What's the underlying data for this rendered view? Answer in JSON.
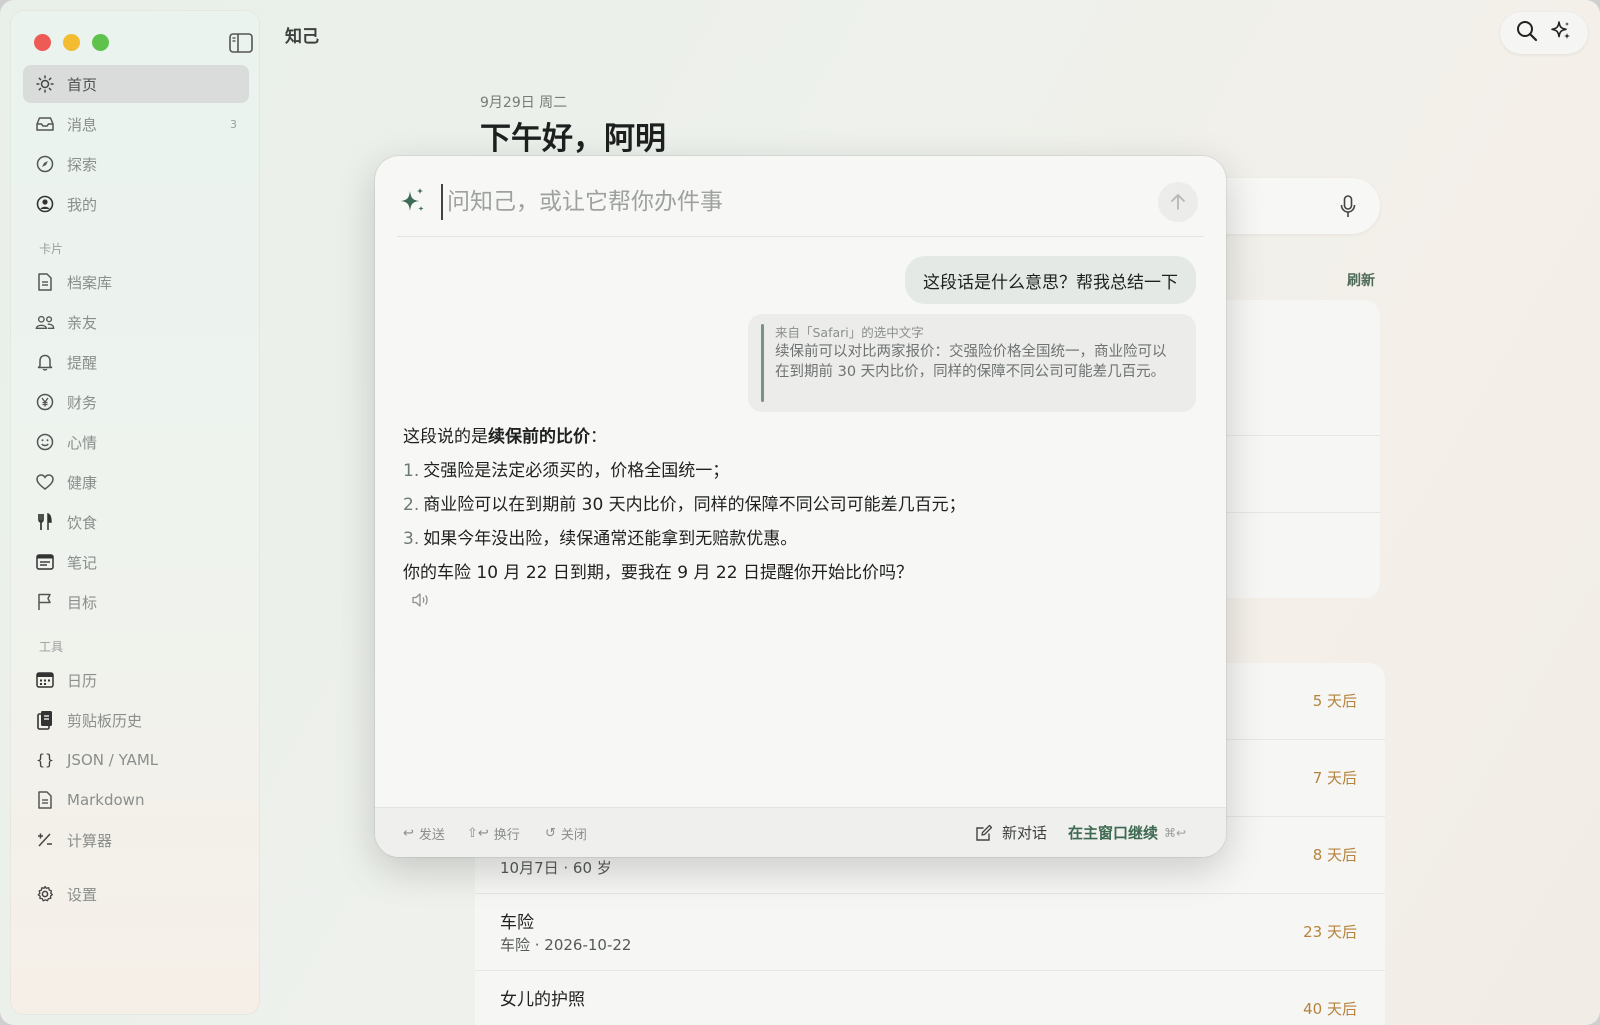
{
  "app": {
    "title": "知己"
  },
  "sidebar": {
    "items": [
      {
        "label": "首页",
        "icon": "sun-icon",
        "active": true
      },
      {
        "label": "消息",
        "icon": "inbox-icon",
        "badge": "3"
      },
      {
        "label": "探索",
        "icon": "compass-icon"
      },
      {
        "label": "我的",
        "icon": "user-circle-icon"
      }
    ],
    "cards_label": "卡片",
    "cards": [
      {
        "label": "档案库",
        "icon": "document-icon"
      },
      {
        "label": "亲友",
        "icon": "people-icon"
      },
      {
        "label": "提醒",
        "icon": "bell-icon"
      },
      {
        "label": "财务",
        "icon": "yen-icon"
      },
      {
        "label": "心情",
        "icon": "smiley-icon"
      },
      {
        "label": "健康",
        "icon": "heart-icon"
      },
      {
        "label": "饮食",
        "icon": "fork-knife-icon"
      },
      {
        "label": "笔记",
        "icon": "notes-icon"
      },
      {
        "label": "目标",
        "icon": "flag-icon"
      }
    ],
    "tools_label": "工具",
    "tools": [
      {
        "label": "日历",
        "icon": "calendar-icon"
      },
      {
        "label": "剪贴板历史",
        "icon": "clipboard-icon"
      },
      {
        "label": "JSON / YAML",
        "icon": "braces-icon"
      },
      {
        "label": "Markdown",
        "icon": "markdown-file-icon"
      },
      {
        "label": "计算器",
        "icon": "calculator-icon"
      }
    ],
    "settings": {
      "label": "设置",
      "icon": "gear-icon"
    }
  },
  "home": {
    "date": "9月29日 周二",
    "greeting": "下午好，阿明",
    "refresh": "刷新",
    "reminders": [
      {
        "title": "",
        "sub": "",
        "due": "5 天后"
      },
      {
        "title": "",
        "sub": "",
        "due": "7 天后"
      },
      {
        "title": "",
        "sub": "10月7日 · 60 岁",
        "due": "8 天后"
      },
      {
        "title": "车险",
        "sub": "车险 · 2026-10-22",
        "due": "23 天后"
      },
      {
        "title": "女儿的护照",
        "sub": "",
        "due": "40 天后"
      }
    ]
  },
  "assistant": {
    "placeholder": "问知己，或让它帮你办件事",
    "user_message": "这段话是什么意思？帮我总结一下",
    "quote_source": "来自「Safari」的选中文字",
    "quote_text": "续保前可以对比两家报价：交强险价格全国统一，商业险可以在到期前 30 天内比价，同样的保障不同公司可能差几百元。",
    "answer": {
      "intro_prefix": "这段说的是",
      "intro_bold": "续保前的比价",
      "intro_suffix": "：",
      "points": [
        {
          "num": "1.",
          "text": "交强险是法定必须买的，价格全国统一；"
        },
        {
          "num": "2.",
          "text": "商业险可以在到期前 30 天内比价，同样的保障不同公司可能差几百元；"
        },
        {
          "num": "3.",
          "text": "如果今年没出险，续保通常还能拿到无赔款优惠。"
        }
      ],
      "question": "你的车险 10 月 22 日到期，要我在 9 月 22 日提醒你开始比价吗？"
    },
    "footer": {
      "send": "发送",
      "newline": "换行",
      "close": "关闭",
      "new_chat": "新对话",
      "continue": "在主窗口继续",
      "continue_shortcut": "⌘↩"
    }
  }
}
